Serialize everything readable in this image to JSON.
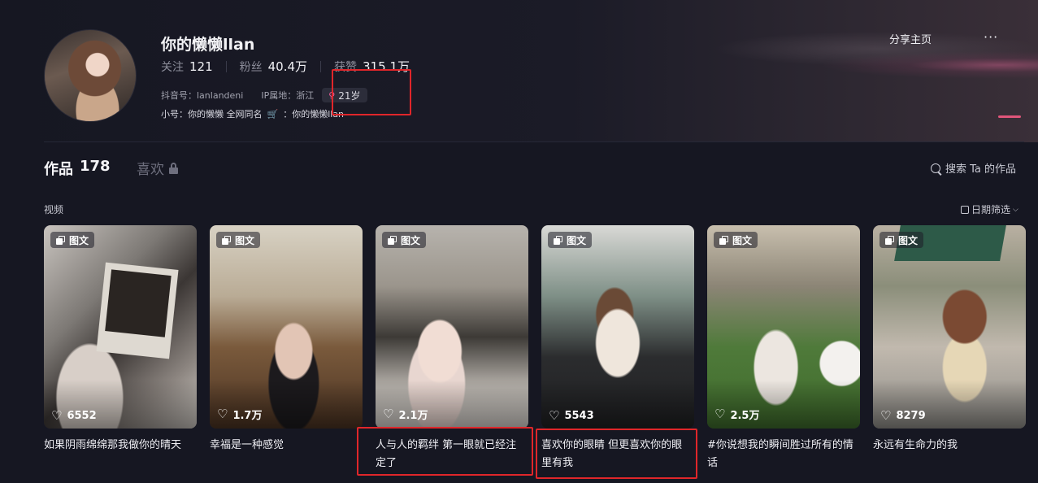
{
  "profile": {
    "name": "你的懒懒llan",
    "stats": [
      {
        "label": "关注",
        "value": "121"
      },
      {
        "label": "粉丝",
        "value": "40.4万"
      },
      {
        "label": "获赞",
        "value": "315.1万"
      }
    ],
    "douyin_id_label": "抖音号：",
    "douyin_id": "lanlandeni",
    "ip_label": "IP属地：",
    "ip_location": "浙江",
    "age": "21岁",
    "sub_account_label": "小号：",
    "sub_account_text": "你的懒懒 全网同名",
    "shop_sep": "：",
    "shop_name": "你的懒懒llan"
  },
  "header_actions": {
    "share": "分享主页",
    "more": "···"
  },
  "tabs": {
    "works_label": "作品",
    "works_count": "178",
    "likes_label": "喜欢"
  },
  "search": {
    "label": "搜索 Ta 的作品"
  },
  "section": {
    "title": "视频",
    "date_filter": "日期筛选"
  },
  "posts": [
    {
      "badge": "图文",
      "likes": "6552",
      "caption": "如果阴雨绵绵那我做你的晴天"
    },
    {
      "badge": "图文",
      "likes": "1.7万",
      "caption": "幸福是一种感觉"
    },
    {
      "badge": "图文",
      "likes": "2.1万",
      "caption": "人与人的羁绊 第一眼就已经注定了"
    },
    {
      "badge": "图文",
      "likes": "5543",
      "caption": "喜欢你的眼睛 但更喜欢你的眼里有我"
    },
    {
      "badge": "图文",
      "likes": "2.5万",
      "caption": "#你说想我的瞬间胜过所有的情话"
    },
    {
      "badge": "图文",
      "likes": "8279",
      "caption": "永远有生命力的我"
    }
  ],
  "colors": {
    "background": "#161722",
    "accent": "#e0557a",
    "annotation": "#e0262a"
  }
}
